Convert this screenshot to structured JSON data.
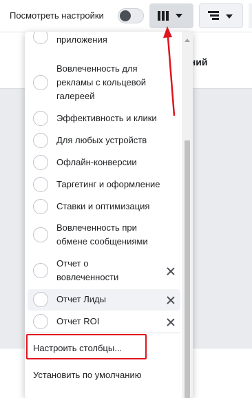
{
  "toolbar": {
    "view_settings_label": "Посмотреть настройки",
    "view_settings_toggle": "off",
    "columns_button_icon": "columns-icon",
    "breakdown_button_icon": "breakdown-icon"
  },
  "background": {
    "partial_header_text": "ений"
  },
  "dropdown": {
    "items": [
      {
        "label": "приложения",
        "removable": false,
        "highlighted": false
      },
      {
        "label": "Вовлеченность для\nрекламы с кольцевой\nгалереей",
        "removable": false,
        "highlighted": false
      },
      {
        "label": "Эффективность и клики",
        "removable": false,
        "highlighted": false
      },
      {
        "label": "Для любых устройств",
        "removable": false,
        "highlighted": false
      },
      {
        "label": "Офлайн-конверсии",
        "removable": false,
        "highlighted": false
      },
      {
        "label": "Таргетинг и оформление",
        "removable": false,
        "highlighted": false
      },
      {
        "label": "Ставки и оптимизация",
        "removable": false,
        "highlighted": false
      },
      {
        "label": "Вовлеченность при\nобмене сообщениями",
        "removable": false,
        "highlighted": false
      },
      {
        "label": "Отчет о\nвовлеченности",
        "removable": true,
        "highlighted": false
      },
      {
        "label": "Отчет Лиды",
        "removable": true,
        "highlighted": true
      },
      {
        "label": "Отчет ROI",
        "removable": true,
        "highlighted": false
      }
    ],
    "customize_columns": "Настроить столбцы...",
    "set_default": "Установить по умолчанию"
  },
  "annotation": {
    "color": "#e0141e"
  }
}
